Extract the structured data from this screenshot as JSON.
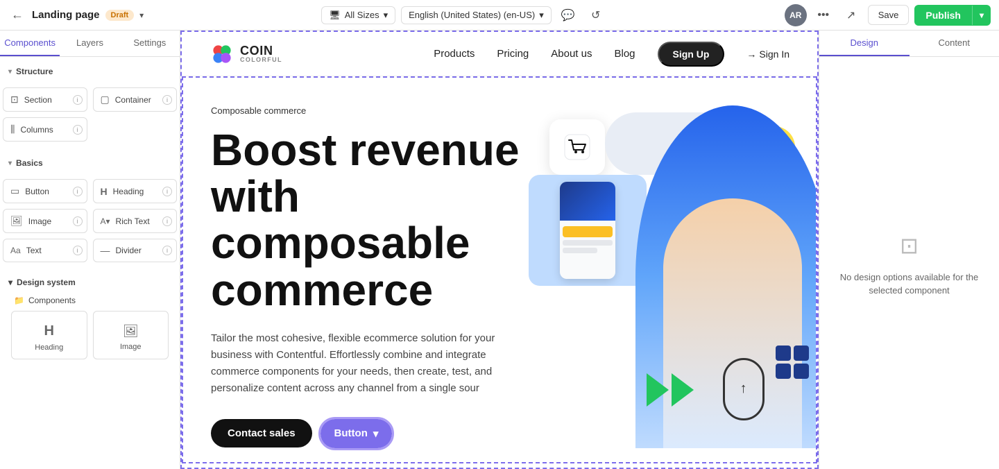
{
  "topbar": {
    "back_label": "←",
    "page_title": "Landing page",
    "draft_label": "Draft",
    "chevron": "▾",
    "size_selector": "All Sizes",
    "lang_selector": "English (United States) (en-US)",
    "comment_icon": "💬",
    "share_icon": "⬡",
    "more_icon": "•••",
    "external_icon": "⬡",
    "save_label": "Save",
    "publish_label": "Publish",
    "publish_arrow": "▾",
    "avatar_initials": "AR"
  },
  "left_sidebar": {
    "tabs": [
      {
        "id": "components",
        "label": "Components",
        "active": true
      },
      {
        "id": "layers",
        "label": "Layers",
        "active": false
      },
      {
        "id": "settings",
        "label": "Settings",
        "active": false
      }
    ],
    "structure_header": "Structure",
    "structure_items": [
      {
        "id": "section",
        "label": "Section",
        "icon": "▭"
      },
      {
        "id": "container",
        "label": "Container",
        "icon": "▢"
      },
      {
        "id": "columns",
        "label": "Columns",
        "icon": "⫼"
      }
    ],
    "basics_header": "Basics",
    "basics_items": [
      {
        "id": "button",
        "label": "Button",
        "icon": "▭"
      },
      {
        "id": "heading",
        "label": "Heading",
        "icon": "H"
      },
      {
        "id": "image",
        "label": "Image",
        "icon": "🖼"
      },
      {
        "id": "rich_text",
        "label": "Rich Text",
        "icon": "A"
      },
      {
        "id": "text",
        "label": "Text",
        "icon": "Aa"
      },
      {
        "id": "divider",
        "label": "Divider",
        "icon": "—"
      }
    ],
    "design_system_header": "Design system",
    "components_sub": "Components",
    "ds_items": [
      {
        "id": "heading_ds",
        "label": "Heading",
        "icon": "H"
      },
      {
        "id": "image_ds",
        "label": "Image",
        "icon": "🖼"
      }
    ]
  },
  "website": {
    "logo_text": "Coin",
    "logo_subtext": "COLORFUL",
    "nav_links": [
      "Products",
      "Pricing",
      "About us",
      "Blog"
    ],
    "nav_signup": "Sign Up",
    "nav_signin": "Sign In",
    "hero_label": "Composable commerce",
    "hero_heading": "Boost revenue with composable commerce",
    "hero_body": "Tailor the most cohesive, flexible ecommerce solution for your business with Contentful. Effortlessly combine and integrate commerce components for your needs, then create, test, and personalize content across any channel from a single sour",
    "btn_contact": "Contact sales",
    "btn_button": "Button",
    "btn_chevron": "▾"
  },
  "right_sidebar": {
    "tabs": [
      {
        "id": "design",
        "label": "Design",
        "active": true
      },
      {
        "id": "content",
        "label": "Content",
        "active": false
      }
    ],
    "no_options_text": "No design options available for the selected component"
  }
}
